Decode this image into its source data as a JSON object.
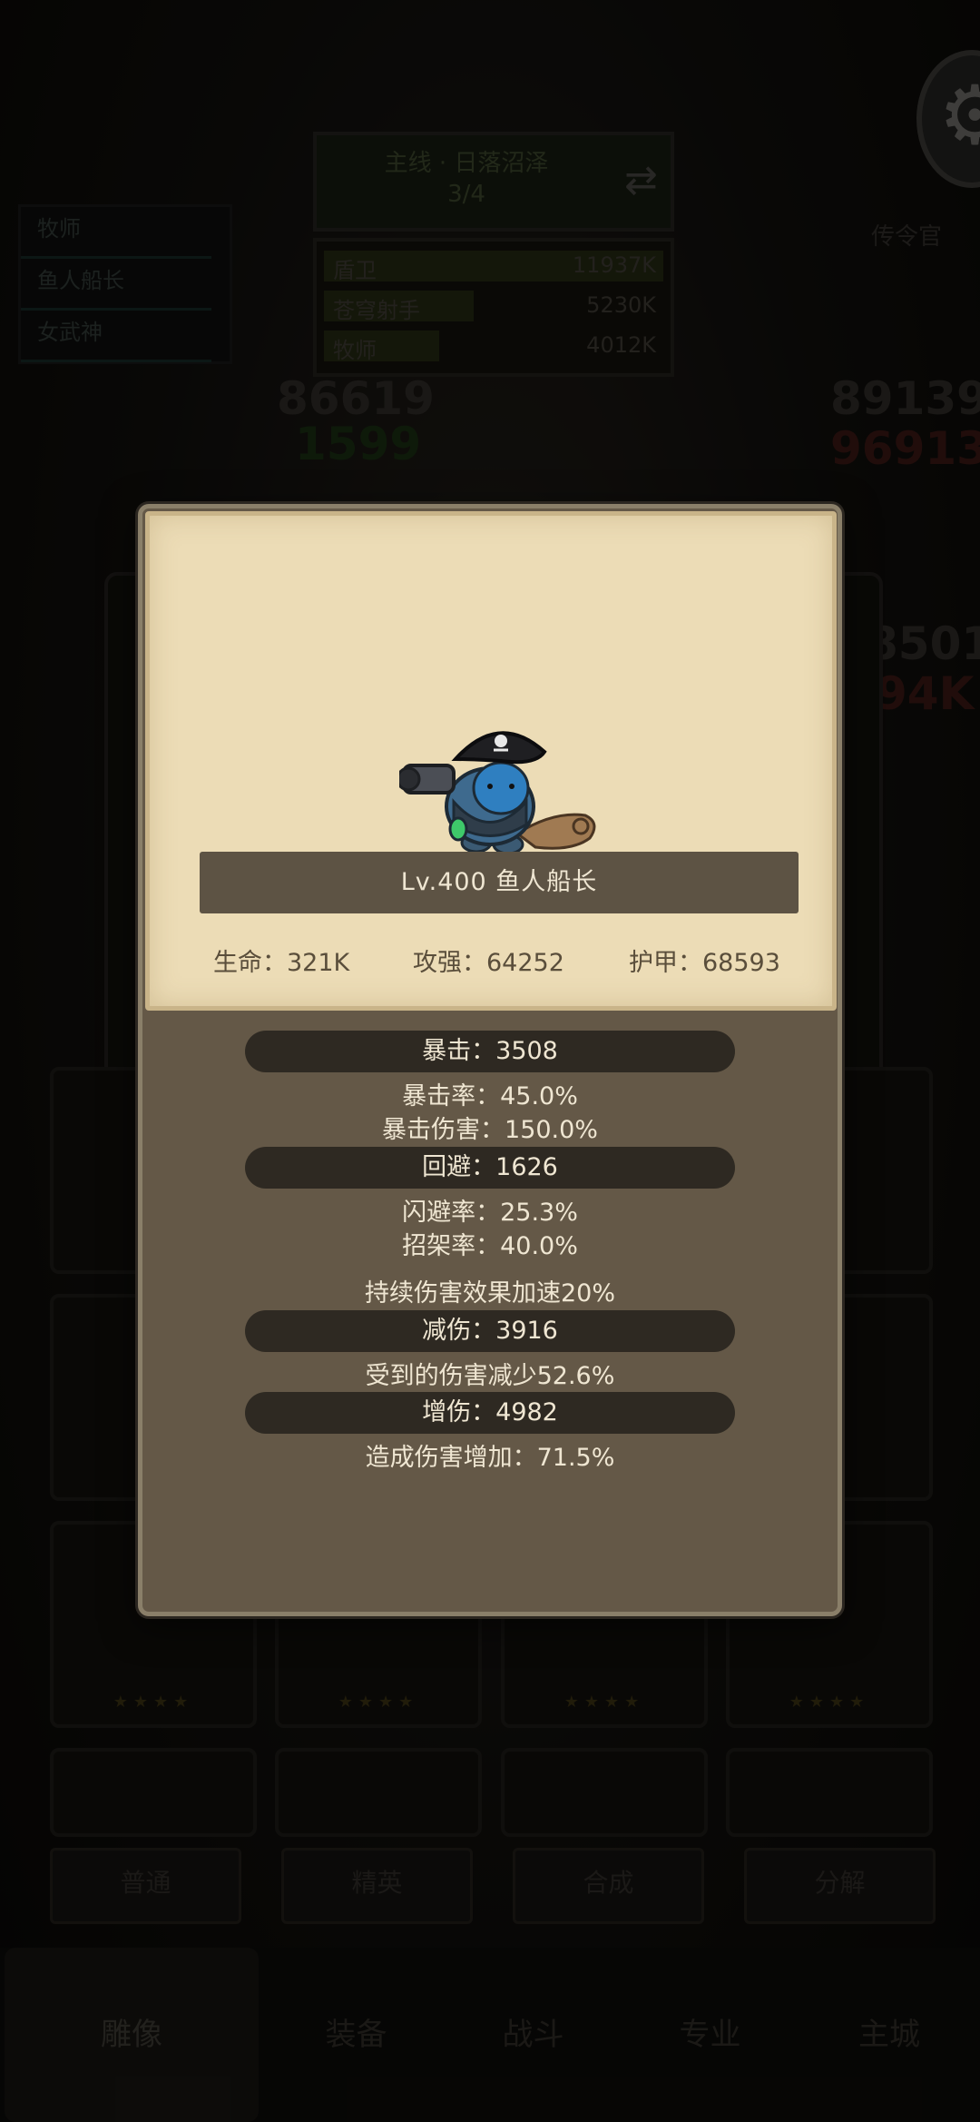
{
  "background": {
    "stage_title": "主线 · 日落沼泽",
    "stage_progress": "3/4",
    "rank_rows": [
      {
        "name": "盾卫",
        "value": "11937K",
        "fill": 1.0
      },
      {
        "name": "苍穹射手",
        "value": "5230K",
        "fill": 0.44
      },
      {
        "name": "牧师",
        "value": "4012K",
        "fill": 0.34
      }
    ],
    "hero_list": [
      "牧师",
      "鱼人船长",
      "女武神"
    ],
    "envoy": "传令官",
    "numbers": [
      "86619",
      "1599",
      "89139",
      "96913",
      "8501",
      "94K"
    ],
    "tab_buttons": [
      "普通",
      "精英",
      "合成",
      "分解"
    ],
    "nav": [
      "雕像",
      "装备",
      "战斗",
      "专业",
      "主城"
    ],
    "settings_icon": "gear-icon"
  },
  "modal": {
    "name_banner": "Lv.400 鱼人船长",
    "base_stats": {
      "hp": "生命：321K",
      "attack": "攻强：64252",
      "armor": "护甲：68593"
    },
    "crit_header": "暴击：3508",
    "crit_rate": "暴击率：45.0%",
    "crit_damage": "暴击伤害：150.0%",
    "dodge_header": "回避：1626",
    "dodge_rate": "闪避率：25.3%",
    "parry_rate": "招架率：40.0%",
    "dot_speed": "持续伤害效果加速20%",
    "reduction_header": "减伤：3916",
    "reduction_text": "受到的伤害减少52.6%",
    "amplify_header": "增伤：4982",
    "amplify_text": "造成伤害增加：71.5%"
  },
  "colors": {
    "modal_bg": "#645847",
    "card_bg": "#ecdcb6",
    "banner_bg": "#5d5344",
    "header_pill": "#2e2922"
  }
}
